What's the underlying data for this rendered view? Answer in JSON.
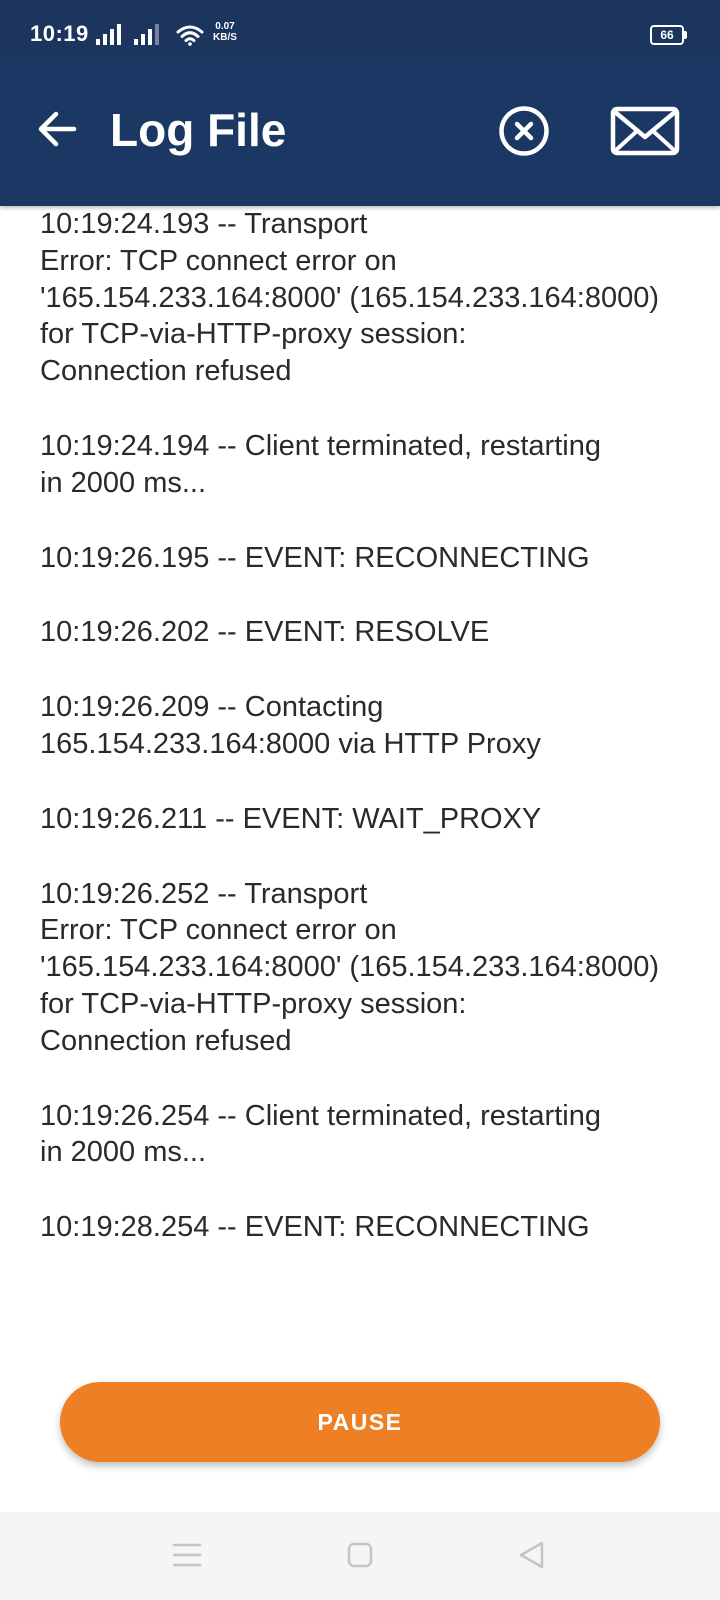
{
  "status_bar": {
    "time": "10:19",
    "net_speed_value": "0.07",
    "net_speed_unit": "KB/S",
    "battery_level": "66",
    "background": "#1b355f"
  },
  "app_bar": {
    "title": "Log File",
    "background": "#1b3763",
    "icons": [
      "arrow-back-icon",
      "clear-circle-icon",
      "envelope-icon"
    ]
  },
  "log": {
    "entries": [
      "10:19:24.193 -- Transport\nError: TCP connect error on\n'165.154.233.164:8000' (165.154.233.164:8000)\nfor TCP-via-HTTP-proxy session:\nConnection refused",
      "10:19:24.194 -- Client terminated, restarting\nin 2000 ms...",
      "10:19:26.195 -- EVENT: RECONNECTING",
      "10:19:26.202 -- EVENT: RESOLVE",
      "10:19:26.209 -- Contacting\n165.154.233.164:8000 via HTTP Proxy",
      "10:19:26.211 -- EVENT: WAIT_PROXY",
      "10:19:26.252 -- Transport\nError: TCP connect error on\n'165.154.233.164:8000' (165.154.233.164:8000)\nfor TCP-via-HTTP-proxy session:\nConnection refused",
      "10:19:26.254 -- Client terminated, restarting\nin 2000 ms...",
      "10:19:28.254 -- EVENT: RECONNECTING"
    ]
  },
  "actions": {
    "pause_label": "PAUSE",
    "accent_color": "#ef7f24"
  },
  "nav_bar": {
    "icons": [
      "menu-icon",
      "home-square-icon",
      "back-triangle-icon"
    ]
  }
}
